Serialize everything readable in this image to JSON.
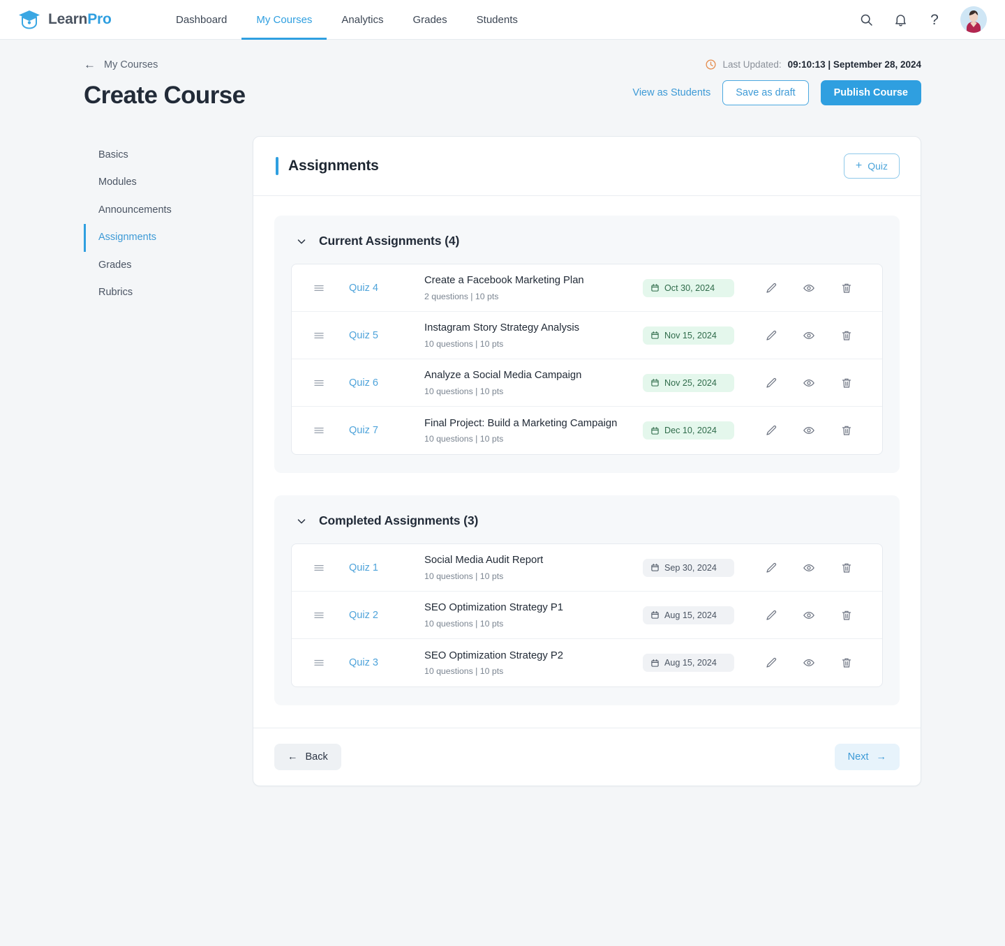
{
  "brand": {
    "learn": "Learn",
    "pro": "Pro",
    "icon": "graduation-cap-icon"
  },
  "nav": {
    "links": [
      {
        "label": "Dashboard",
        "active": false
      },
      {
        "label": "My Courses",
        "active": true
      },
      {
        "label": "Analytics",
        "active": false
      },
      {
        "label": "Grades",
        "active": false
      },
      {
        "label": "Students",
        "active": false
      }
    ],
    "icons": [
      "search-icon",
      "bell-icon",
      "help-icon"
    ],
    "help_glyph": "?"
  },
  "breadcrumb": {
    "back_arrow": "←",
    "label": "My Courses"
  },
  "last_updated": {
    "icon": "clock-icon",
    "label": "Last Updated:",
    "value": "09:10:13  |  September 28, 2024"
  },
  "header": {
    "title": "Create Course",
    "view_as_students": "View as Students",
    "save_as_draft": "Save as draft",
    "publish_course": "Publish Course"
  },
  "sidebar": {
    "items": [
      {
        "label": "Basics",
        "active": false
      },
      {
        "label": "Modules",
        "active": false
      },
      {
        "label": "Announcements",
        "active": false
      },
      {
        "label": "Assignments",
        "active": true
      },
      {
        "label": "Grades",
        "active": false
      },
      {
        "label": "Rubrics",
        "active": false
      }
    ]
  },
  "panel": {
    "title": "Assignments",
    "add_quiz_label": "Quiz",
    "add_quiz_plus": "+"
  },
  "sections": [
    {
      "title": "Current Assignments (4)",
      "badge_style": "green",
      "rows": [
        {
          "quiz": "Quiz 4",
          "title": "Create a Facebook Marketing Plan",
          "meta": "2 questions | 10 pts",
          "date": "Oct 30, 2024"
        },
        {
          "quiz": "Quiz 5",
          "title": "Instagram Story Strategy Analysis",
          "meta": "10 questions | 10 pts",
          "date": "Nov 15, 2024"
        },
        {
          "quiz": "Quiz 6",
          "title": "Analyze a Social Media Campaign",
          "meta": "10 questions | 10 pts",
          "date": "Nov 25, 2024"
        },
        {
          "quiz": "Quiz 7",
          "title": "Final Project: Build a Marketing Campaign",
          "meta": "10 questions | 10 pts",
          "date": "Dec 10, 2024"
        }
      ]
    },
    {
      "title": "Completed Assignments (3)",
      "badge_style": "gray",
      "rows": [
        {
          "quiz": "Quiz 1",
          "title": "Social Media Audit Report",
          "meta": "10 questions | 10 pts",
          "date": "Sep 30, 2024"
        },
        {
          "quiz": "Quiz 2",
          "title": "SEO Optimization Strategy P1",
          "meta": "10 questions | 10 pts",
          "date": "Aug 15, 2024"
        },
        {
          "quiz": "Quiz 3",
          "title": "SEO Optimization Strategy P2",
          "meta": "10 questions | 10 pts",
          "date": "Aug 15, 2024"
        }
      ]
    }
  ],
  "row_actions": {
    "edit": "pencil-icon",
    "preview": "eye-icon",
    "delete": "trash-icon"
  },
  "footer": {
    "back_label": "Back",
    "back_arrow": "←",
    "next_label": "Next",
    "next_arrow": "→"
  },
  "colors": {
    "accent": "#2f9fe0",
    "page_bg": "#f4f6f8",
    "badge_green_bg": "#e4f7ec",
    "badge_green_text": "#2f6b4a",
    "badge_gray_bg": "#f0f2f5",
    "clock_icon": "#e58a4a"
  }
}
